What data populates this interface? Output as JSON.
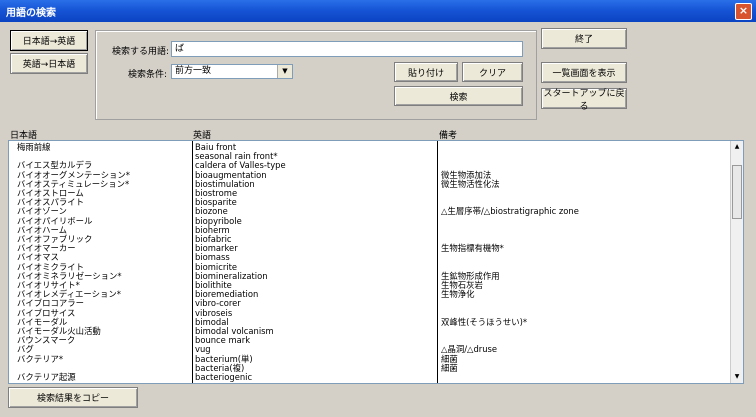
{
  "window": {
    "title": "用語の検索",
    "close_glyph": "×"
  },
  "mode_buttons": {
    "ja_to_en": "日本語→英語",
    "en_to_ja": "英語→日本語"
  },
  "search": {
    "term_label": "検索する用語:",
    "term_value": "ば",
    "condition_label": "検索条件:",
    "condition_value": "前方一致"
  },
  "buttons": {
    "paste": "貼り付け",
    "clear": "クリア",
    "search": "検索",
    "exit": "終了",
    "list_view": "一覧画面を表示",
    "back_to_startup": "スタートアップに戻る",
    "copy_results": "検索結果をコピー"
  },
  "columns": {
    "japanese": "日本語",
    "english": "英語",
    "notes": "備考"
  },
  "rows": [
    {
      "ja": "梅雨前線",
      "en": "Baiu front",
      "note": ""
    },
    {
      "ja": "",
      "en": "seasonal rain front*",
      "note": ""
    },
    {
      "ja": "バイエス型カルデラ",
      "en": "caldera of Valles-type",
      "note": ""
    },
    {
      "ja": "バイオオーグメンテーション*",
      "en": "bioaugmentation",
      "note": "微生物添加法"
    },
    {
      "ja": "バイオスティミュレーション*",
      "en": "biostimulation",
      "note": "微生物活性化法"
    },
    {
      "ja": "バイオストローム",
      "en": "biostrome",
      "note": ""
    },
    {
      "ja": "バイオスパライト",
      "en": "biosparite",
      "note": ""
    },
    {
      "ja": "バイオゾーン",
      "en": "biozone",
      "note": "△生層序帯/△biostratigraphic zone"
    },
    {
      "ja": "バイオパイリボール",
      "en": "biopyribole",
      "note": ""
    },
    {
      "ja": "バイオハーム",
      "en": "bioherm",
      "note": ""
    },
    {
      "ja": "バイオファブリック",
      "en": "biofabric",
      "note": ""
    },
    {
      "ja": "バイオマーカー",
      "en": "biomarker",
      "note": "生物指標有機物*"
    },
    {
      "ja": "バイオマス",
      "en": "biomass",
      "note": ""
    },
    {
      "ja": "バイオミクライト",
      "en": "biomicrite",
      "note": ""
    },
    {
      "ja": "バイオミネラリゼーション*",
      "en": "biomineralization",
      "note": "生鉱物形成作用"
    },
    {
      "ja": "バイオリサイト*",
      "en": "biolithite",
      "note": "生物石灰岩"
    },
    {
      "ja": "バイオレメディエーション*",
      "en": "bioremediation",
      "note": "生物浄化"
    },
    {
      "ja": "バイブロコアラー",
      "en": "vibro-corer",
      "note": ""
    },
    {
      "ja": "バイブロサイス",
      "en": "vibroseis",
      "note": ""
    },
    {
      "ja": "バイモーダル",
      "en": "bimodal",
      "note": "双峰性(そうほうせい)*"
    },
    {
      "ja": "バイモーダル火山活動",
      "en": "bimodal volcanism",
      "note": ""
    },
    {
      "ja": "バウンスマーク",
      "en": "bounce mark",
      "note": ""
    },
    {
      "ja": "バグ",
      "en": "vug",
      "note": "△晶洞/△druse"
    },
    {
      "ja": "バクテリア*",
      "en": "bacterium(単)",
      "note": "細菌"
    },
    {
      "ja": "",
      "en": "bacteria(複)",
      "note": "細菌"
    },
    {
      "ja": "バクテリア起源",
      "en": "bacteriogenic",
      "note": ""
    }
  ]
}
